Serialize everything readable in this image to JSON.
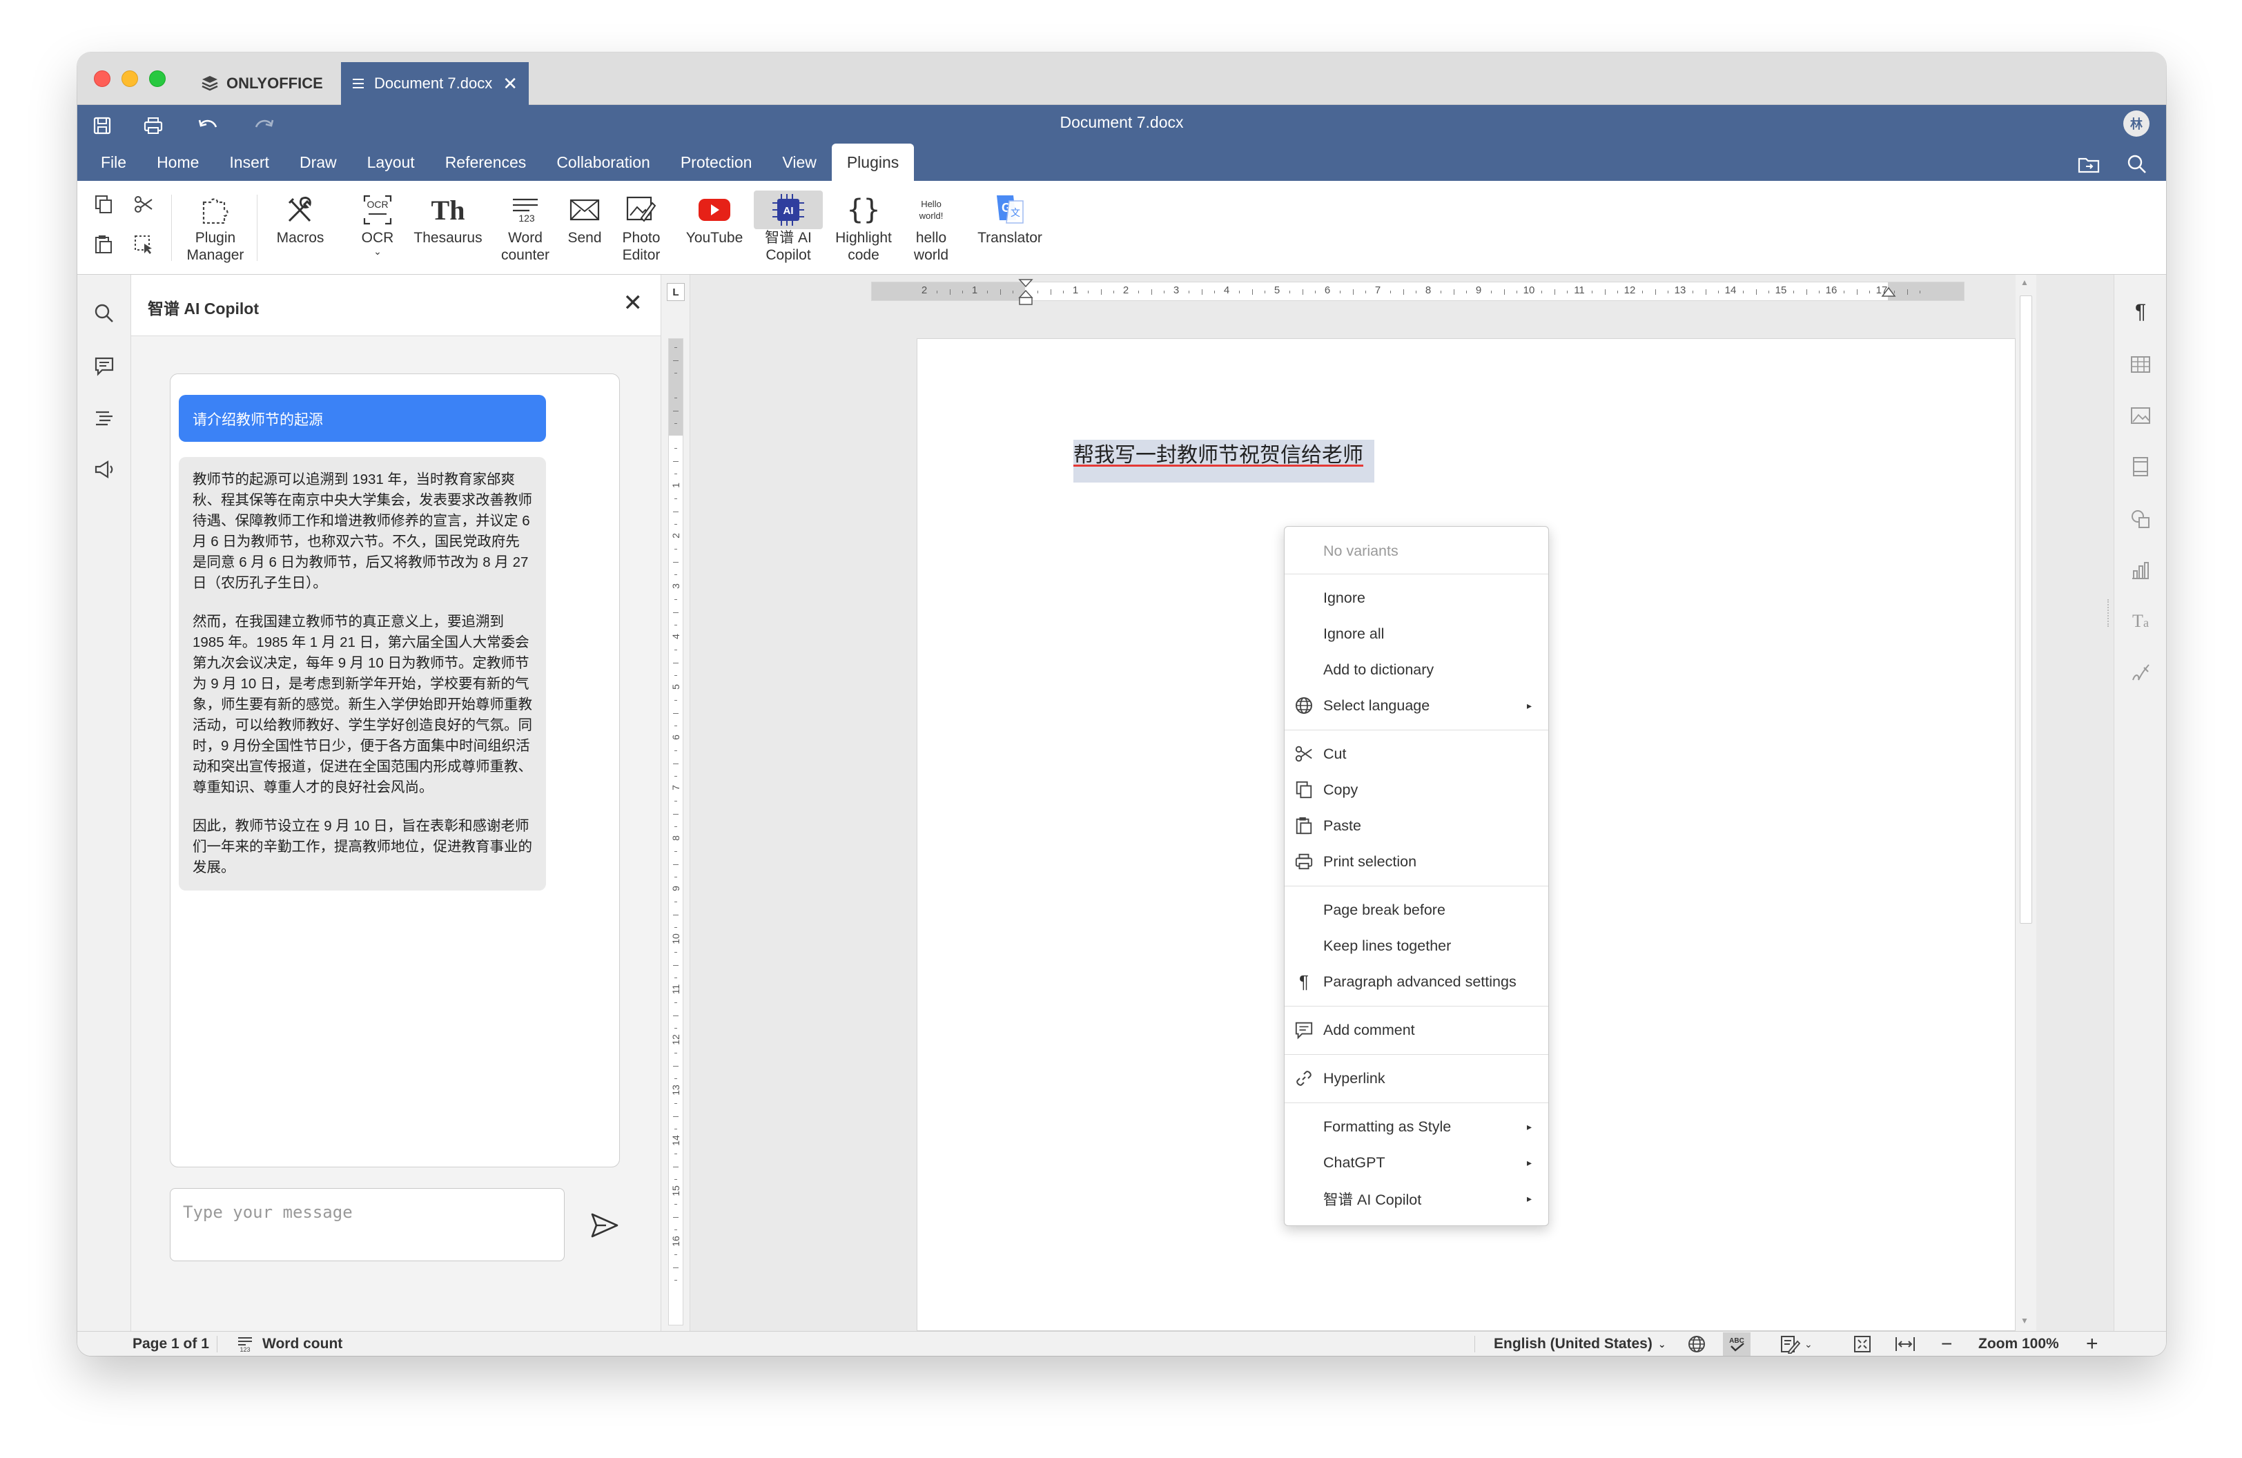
{
  "app": {
    "brand": "ONLYOFFICE",
    "doc_tab": "Document 7.docx",
    "title": "Document 7.docx",
    "avatar": "林"
  },
  "menus": [
    "File",
    "Home",
    "Insert",
    "Draw",
    "Layout",
    "References",
    "Collaboration",
    "Protection",
    "View",
    "Plugins"
  ],
  "toolbar": {
    "plugin_manager": [
      "Plugin",
      "Manager"
    ],
    "macros": "Macros",
    "ocr": "OCR",
    "thesaurus": "Thesaurus",
    "word_counter": [
      "Word",
      "counter"
    ],
    "send": "Send",
    "photo_editor": [
      "Photo",
      "Editor"
    ],
    "youtube": "YouTube",
    "ai_copilot": [
      "智谱 AI",
      "Copilot"
    ],
    "highlight_code": [
      "Highlight",
      "code"
    ],
    "hello_world": [
      "hello",
      "world"
    ],
    "hello_icon": [
      "Hello",
      "world!"
    ],
    "translator": "Translator"
  },
  "panel": {
    "title": "智谱 AI Copilot",
    "user_message": "请介绍教师节的起源",
    "ai_paragraphs": [
      "教师节的起源可以追溯到 1931 年，当时教育家邰爽秋、程其保等在南京中央大学集会，发表要求改善教师待遇、保障教师工作和增进教师修养的宣言，并议定 6 月 6 日为教师节，也称双六节。不久，国民党政府先是同意 6 月 6 日为教师节，后又将教师节改为 8 月 27 日（农历孔子生日）。",
      "然而，在我国建立教师节的真正意义上，要追溯到 1985 年。1985 年 1 月 21 日，第六届全国人大常委会第九次会议决定，每年 9 月 10 日为教师节。定教师节为 9 月 10 日，是考虑到新学年开始，学校要有新的气象，师生要有新的感觉。新生入学伊始即开始尊师重教活动，可以给教师教好、学生学好创造良好的气氛。同时，9 月份全国性节日少，便于各方面集中时间组织活动和突出宣传报道，促进在全国范围内形成尊师重教、尊重知识、尊重人才的良好社会风尚。",
      "因此，教师节设立在 9 月 10 日，旨在表彰和感谢老师们一年来的辛勤工作，提高教师地位，促进教育事业的发展。"
    ],
    "input_placeholder": "Type your message"
  },
  "ruler": {
    "h_numbers_left": [
      "2",
      "1"
    ],
    "h_numbers": [
      "1",
      "2",
      "3",
      "4",
      "5",
      "6",
      "7",
      "8",
      "9",
      "10",
      "11",
      "12",
      "13",
      "14",
      "15",
      "16",
      "17"
    ],
    "v_numbers": [
      "1",
      "2",
      "3",
      "4",
      "5",
      "6",
      "7",
      "8",
      "9",
      "10",
      "11",
      "12",
      "13",
      "14",
      "15",
      "16"
    ]
  },
  "document": {
    "selected_text": "帮我写一封教师节祝贺信给老师"
  },
  "context_menu": {
    "no_variants": "No variants",
    "ignore": "Ignore",
    "ignore_all": "Ignore all",
    "add_to_dictionary": "Add to dictionary",
    "select_language": "Select language",
    "cut": "Cut",
    "copy": "Copy",
    "paste": "Paste",
    "print_selection": "Print selection",
    "page_break_before": "Page break before",
    "keep_lines_together": "Keep lines together",
    "paragraph_advanced_settings": "Paragraph advanced settings",
    "add_comment": "Add comment",
    "hyperlink": "Hyperlink",
    "formatting_as_style": "Formatting as Style",
    "chatgpt": "ChatGPT",
    "ai_copilot": "智谱 AI Copilot"
  },
  "status": {
    "page": "Page 1 of 1",
    "word_count": "Word count",
    "language": "English (United States)",
    "zoom": "Zoom 100%"
  },
  "colors": {
    "header": "#4a6694",
    "user_bubble": "#3b82f6",
    "ai_bubble": "#eaeaea",
    "spell_underline": "#e53935"
  }
}
